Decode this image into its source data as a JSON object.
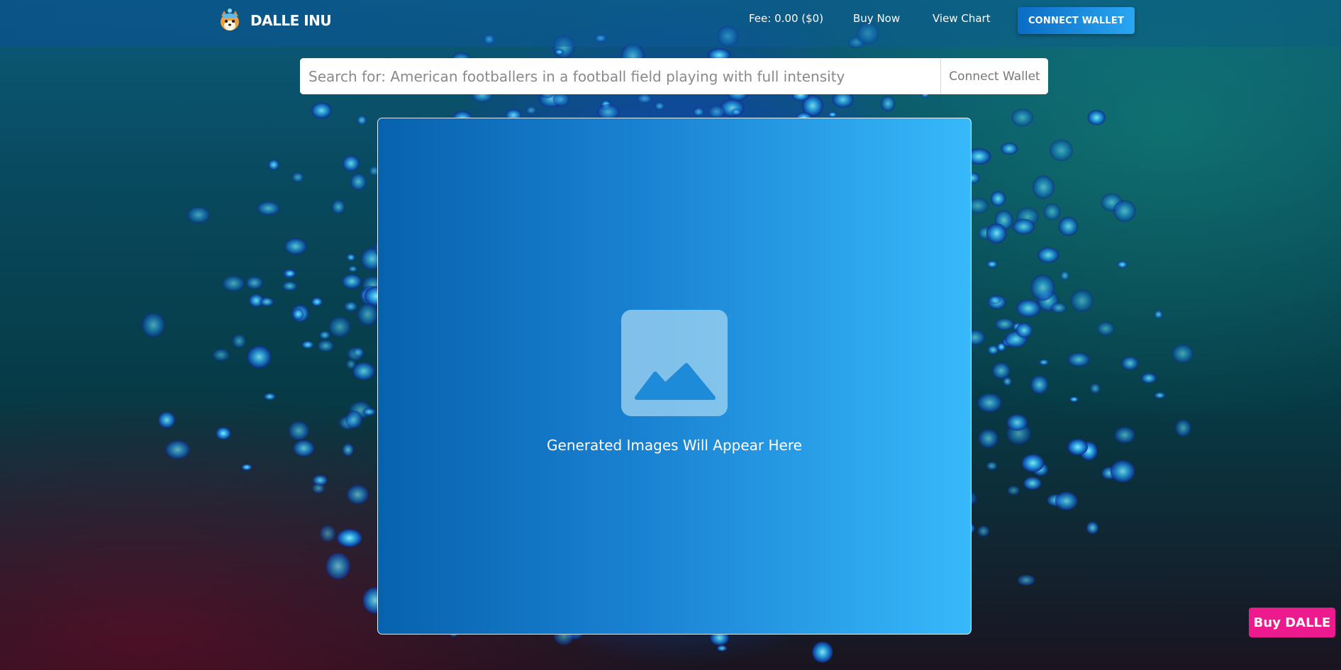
{
  "brand": {
    "name": "DALLE INU"
  },
  "nav": {
    "fee": "Fee: 0.00 ($0)",
    "buy_now": "Buy Now",
    "view_chart": "View Chart",
    "connect_wallet": "CONNECT WALLET"
  },
  "search": {
    "placeholder": "Search for: American footballers in a football field playing with full intensity",
    "value": "",
    "button_label": "Connect Wallet"
  },
  "main": {
    "placeholder_icon": "image-icon",
    "placeholder_text": "Generated Images Will Appear Here"
  },
  "floating": {
    "buy_label": "Buy DALLE"
  },
  "colors": {
    "accent_blue": "#0b6cc4",
    "accent_light_blue": "#37b9fb",
    "buy_pink": "#ec1a8c"
  }
}
